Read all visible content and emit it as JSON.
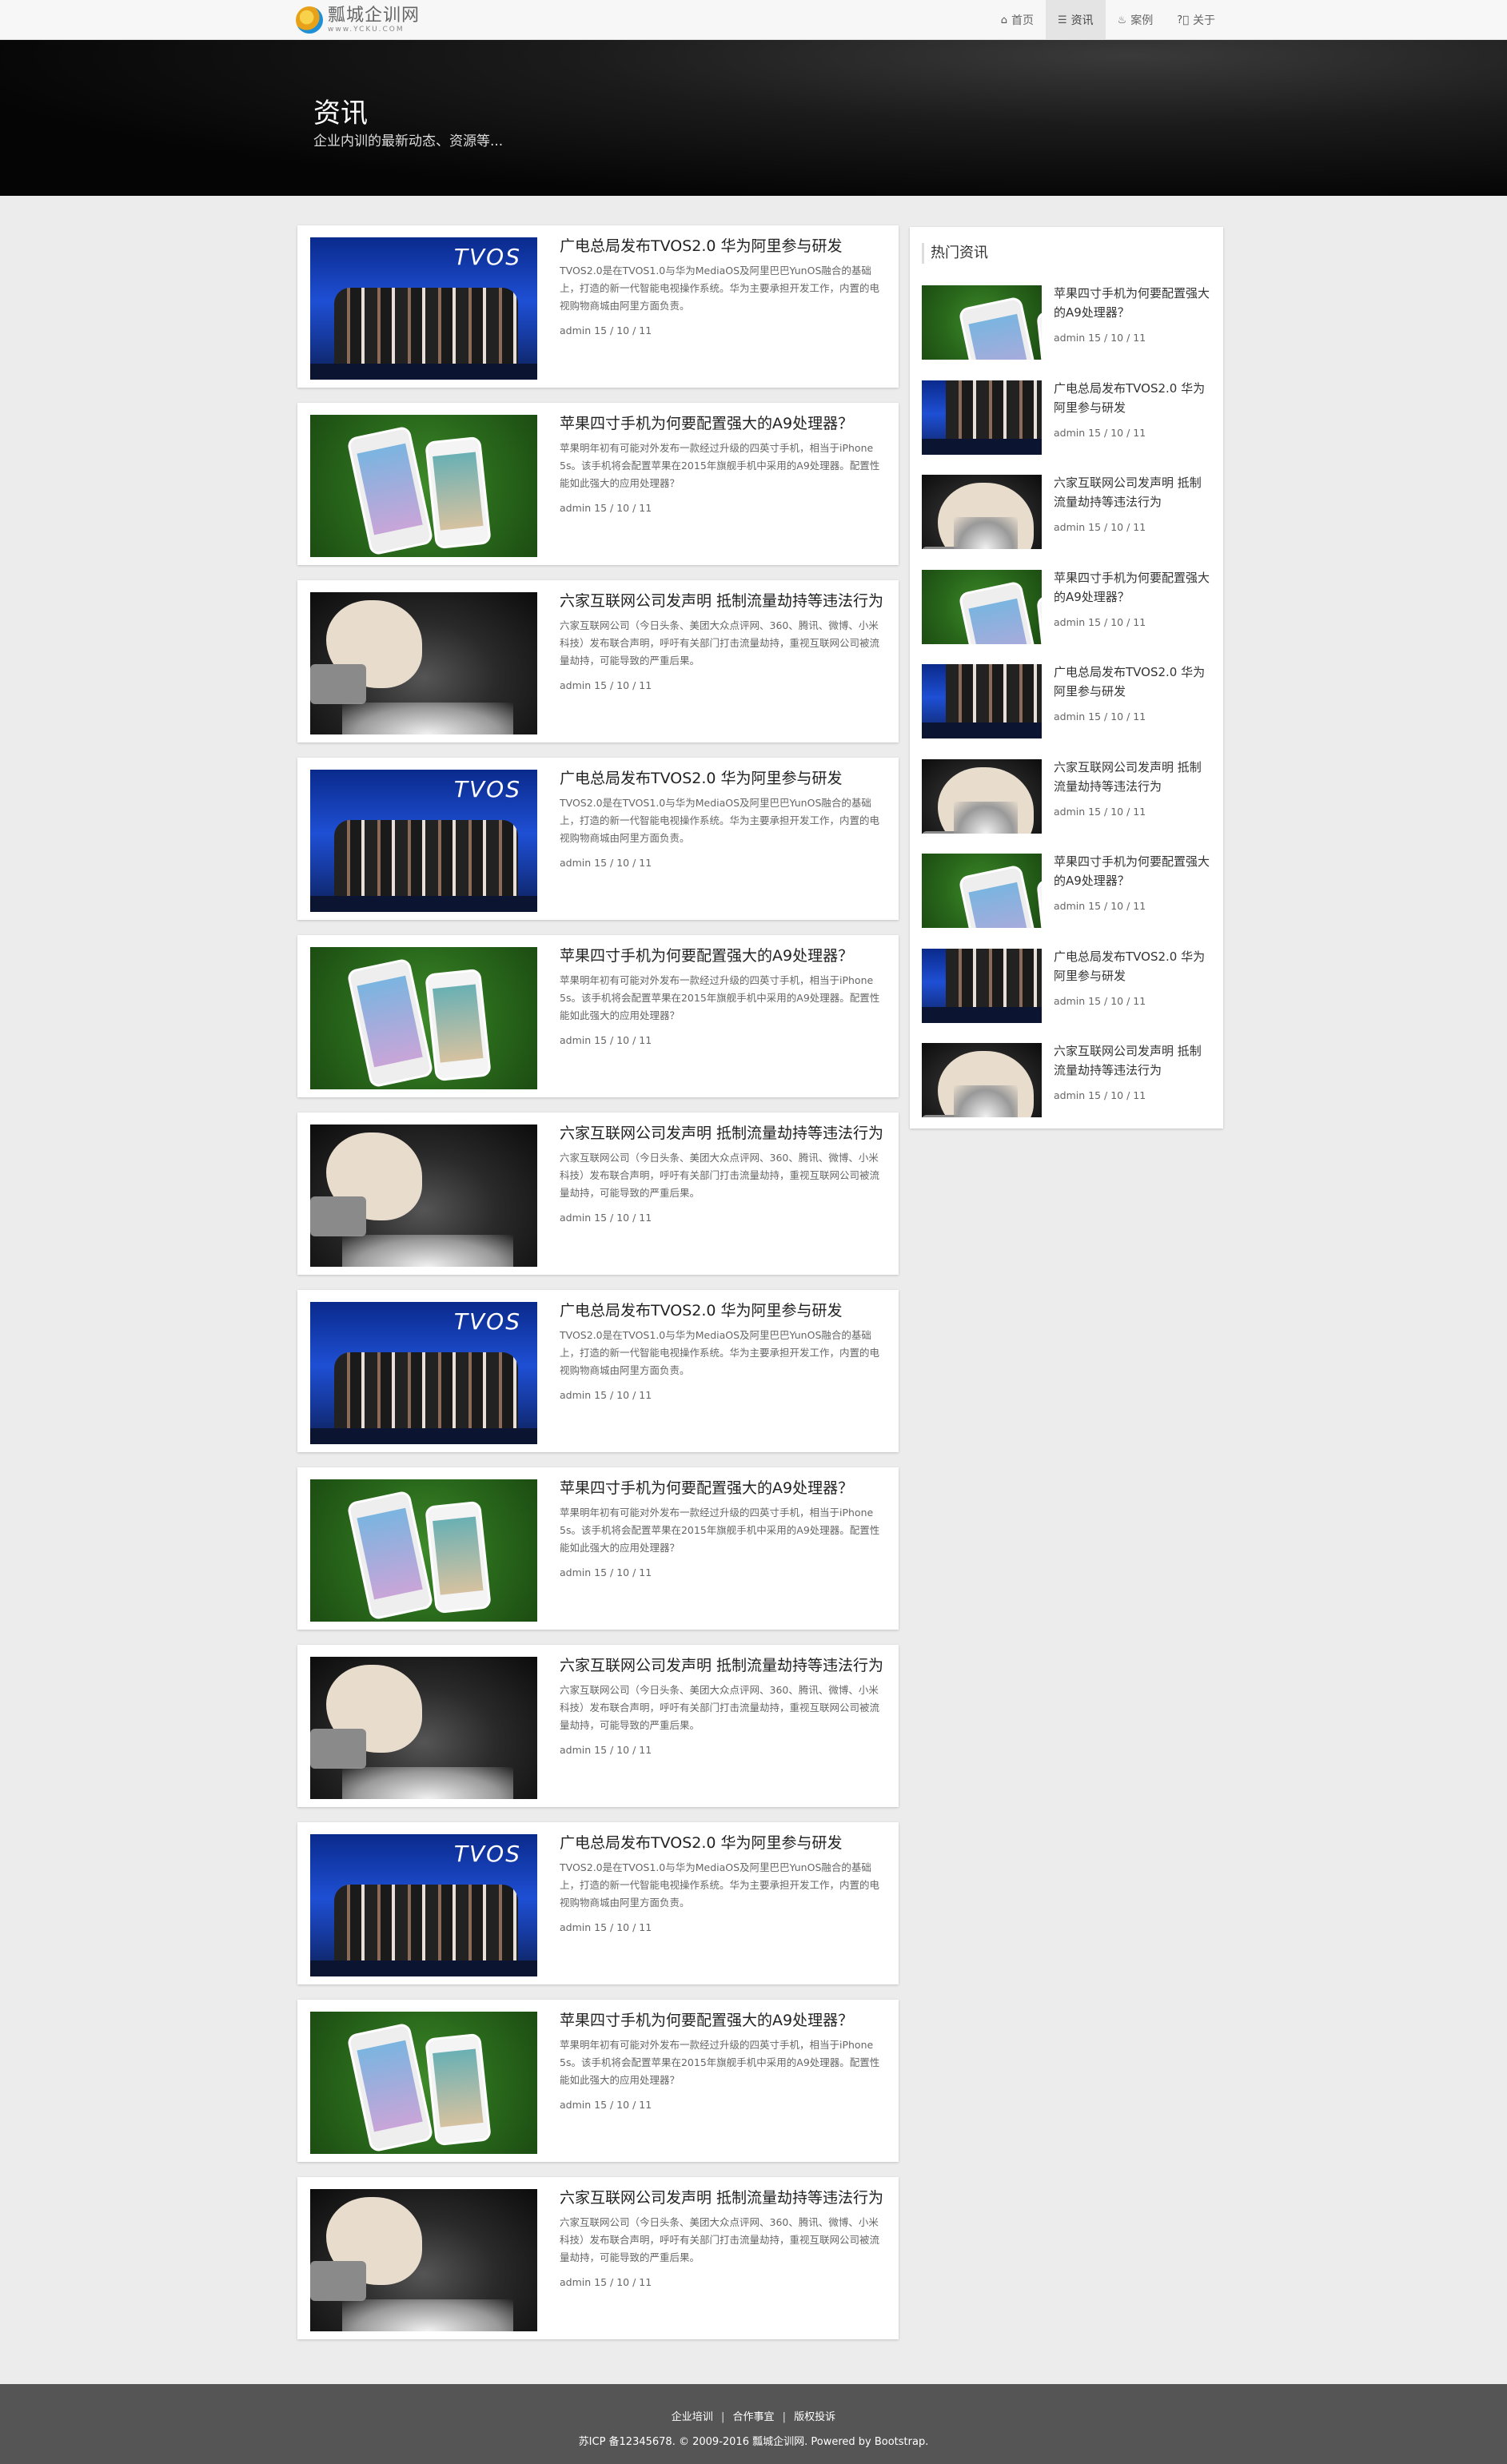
{
  "header": {
    "logo_cn": "瓢城企训网",
    "logo_en": "www.YCKU.COM",
    "nav": [
      {
        "label": "首页",
        "icon": "home-icon",
        "active": false
      },
      {
        "label": "资讯",
        "icon": "list-icon",
        "active": true
      },
      {
        "label": "案例",
        "icon": "fire-icon",
        "active": false
      },
      {
        "label": "关于",
        "icon": "question-circle-icon",
        "active": false
      }
    ]
  },
  "banner": {
    "title": "资讯",
    "subtitle": "企业内训的最新动态、资源等..."
  },
  "articles": [
    {
      "title": "广电总局发布TVOS2.0 华为阿里参与研发",
      "summary": "TVOS2.0是在TVOS1.0与华为MediaOS及阿里巴巴YunOS融合的基础上，打造的新一代智能电视操作系统。华为主要承担开发工作，内置的电视购物商城由阿里方面负责。",
      "meta": "admin 15 / 10 / 11",
      "image": "tv"
    },
    {
      "title": "苹果四寸手机为何要配置强大的A9处理器？",
      "summary": "苹果明年初有可能对外发布一款经过升级的四英寸手机，相当于iPhone 5s。该手机将会配置苹果在2015年旗舰手机中采用的A9处理器。配置性能如此强大的应用处理器？",
      "meta": "admin 15 / 10 / 11",
      "image": "phone"
    },
    {
      "title": "六家互联网公司发声明 抵制流量劫持等违法行为",
      "summary": "六家互联网公司（今日头条、美团大众点评网、360、腾讯、微博、小米科技）发布联合声明，呼吁有关部门打击流量劫持，重视互联网公司被流量劫持，可能导致的严重后果。",
      "meta": "admin 15 / 10 / 11",
      "image": "hand"
    },
    {
      "title": "广电总局发布TVOS2.0 华为阿里参与研发",
      "summary": "TVOS2.0是在TVOS1.0与华为MediaOS及阿里巴巴YunOS融合的基础上，打造的新一代智能电视操作系统。华为主要承担开发工作，内置的电视购物商城由阿里方面负责。",
      "meta": "admin 15 / 10 / 11",
      "image": "tv"
    },
    {
      "title": "苹果四寸手机为何要配置强大的A9处理器？",
      "summary": "苹果明年初有可能对外发布一款经过升级的四英寸手机，相当于iPhone 5s。该手机将会配置苹果在2015年旗舰手机中采用的A9处理器。配置性能如此强大的应用处理器？",
      "meta": "admin 15 / 10 / 11",
      "image": "phone"
    },
    {
      "title": "六家互联网公司发声明 抵制流量劫持等违法行为",
      "summary": "六家互联网公司（今日头条、美团大众点评网、360、腾讯、微博、小米科技）发布联合声明，呼吁有关部门打击流量劫持，重视互联网公司被流量劫持，可能导致的严重后果。",
      "meta": "admin 15 / 10 / 11",
      "image": "hand"
    },
    {
      "title": "广电总局发布TVOS2.0 华为阿里参与研发",
      "summary": "TVOS2.0是在TVOS1.0与华为MediaOS及阿里巴巴YunOS融合的基础上，打造的新一代智能电视操作系统。华为主要承担开发工作，内置的电视购物商城由阿里方面负责。",
      "meta": "admin 15 / 10 / 11",
      "image": "tv"
    },
    {
      "title": "苹果四寸手机为何要配置强大的A9处理器？",
      "summary": "苹果明年初有可能对外发布一款经过升级的四英寸手机，相当于iPhone 5s。该手机将会配置苹果在2015年旗舰手机中采用的A9处理器。配置性能如此强大的应用处理器？",
      "meta": "admin 15 / 10 / 11",
      "image": "phone"
    },
    {
      "title": "六家互联网公司发声明 抵制流量劫持等违法行为",
      "summary": "六家互联网公司（今日头条、美团大众点评网、360、腾讯、微博、小米科技）发布联合声明，呼吁有关部门打击流量劫持，重视互联网公司被流量劫持，可能导致的严重后果。",
      "meta": "admin 15 / 10 / 11",
      "image": "hand"
    },
    {
      "title": "广电总局发布TVOS2.0 华为阿里参与研发",
      "summary": "TVOS2.0是在TVOS1.0与华为MediaOS及阿里巴巴YunOS融合的基础上，打造的新一代智能电视操作系统。华为主要承担开发工作，内置的电视购物商城由阿里方面负责。",
      "meta": "admin 15 / 10 / 11",
      "image": "tv"
    },
    {
      "title": "苹果四寸手机为何要配置强大的A9处理器？",
      "summary": "苹果明年初有可能对外发布一款经过升级的四英寸手机，相当于iPhone 5s。该手机将会配置苹果在2015年旗舰手机中采用的A9处理器。配置性能如此强大的应用处理器？",
      "meta": "admin 15 / 10 / 11",
      "image": "phone"
    },
    {
      "title": "六家互联网公司发声明 抵制流量劫持等违法行为",
      "summary": "六家互联网公司（今日头条、美团大众点评网、360、腾讯、微博、小米科技）发布联合声明，呼吁有关部门打击流量劫持，重视互联网公司被流量劫持，可能导致的严重后果。",
      "meta": "admin 15 / 10 / 11",
      "image": "hand"
    }
  ],
  "sidebar": {
    "heading": "热门资讯",
    "items": [
      {
        "title": "苹果四寸手机为何要配置强大的A9处理器？",
        "meta": "admin 15 / 10 / 11",
        "image": "phone"
      },
      {
        "title": "广电总局发布TVOS2.0 华为阿里参与研发",
        "meta": "admin 15 / 10 / 11",
        "image": "tv"
      },
      {
        "title": "六家互联网公司发声明 抵制流量劫持等违法行为",
        "meta": "admin 15 / 10 / 11",
        "image": "hand"
      },
      {
        "title": "苹果四寸手机为何要配置强大的A9处理器？",
        "meta": "admin 15 / 10 / 11",
        "image": "phone"
      },
      {
        "title": "广电总局发布TVOS2.0 华为阿里参与研发",
        "meta": "admin 15 / 10 / 11",
        "image": "tv"
      },
      {
        "title": "六家互联网公司发声明 抵制流量劫持等违法行为",
        "meta": "admin 15 / 10 / 11",
        "image": "hand"
      },
      {
        "title": "苹果四寸手机为何要配置强大的A9处理器？",
        "meta": "admin 15 / 10 / 11",
        "image": "phone"
      },
      {
        "title": "广电总局发布TVOS2.0 华为阿里参与研发",
        "meta": "admin 15 / 10 / 11",
        "image": "tv"
      },
      {
        "title": "六家互联网公司发声明 抵制流量劫持等违法行为",
        "meta": "admin 15 / 10 / 11",
        "image": "hand"
      }
    ]
  },
  "footer": {
    "links": [
      "企业培训",
      "合作事宜",
      "版权投诉"
    ],
    "separator": "|",
    "copyright": "苏ICP 备12345678. © 2009-2016 瓢城企训网. Powered by Bootstrap."
  }
}
